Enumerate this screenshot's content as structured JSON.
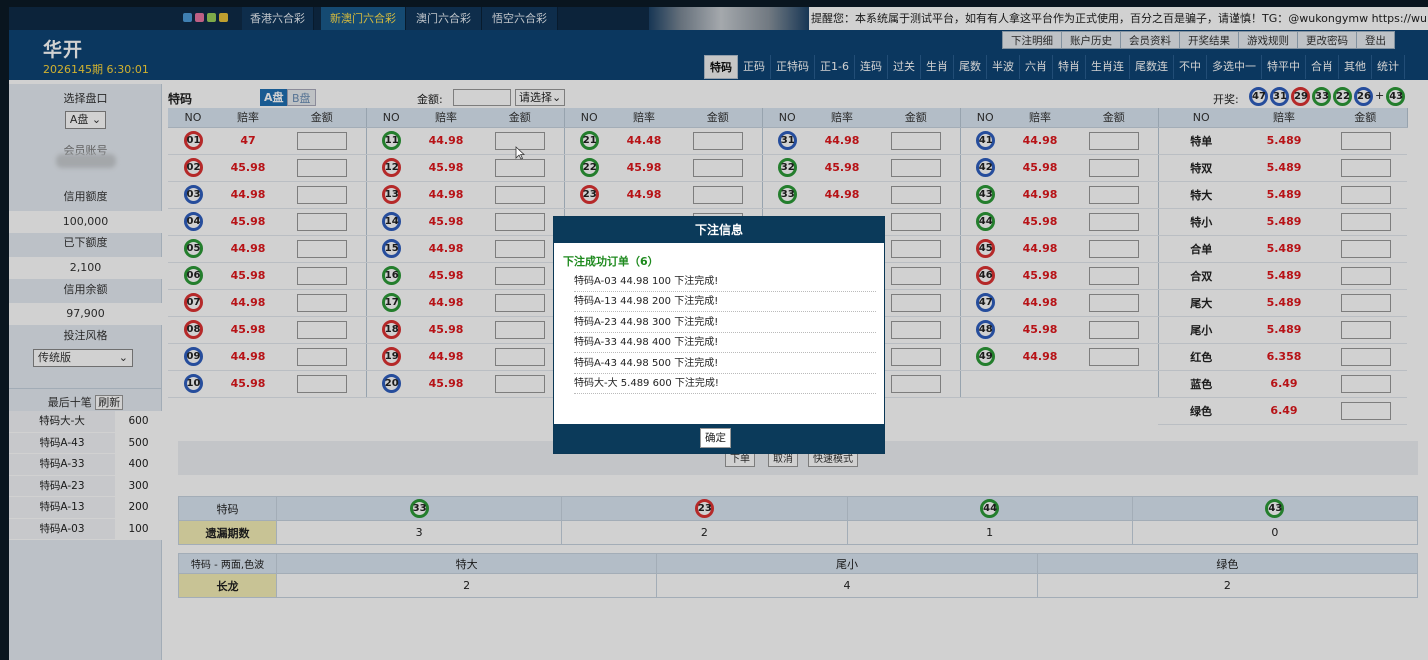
{
  "topbar": {
    "colors": [
      "#4d9bd8",
      "#e874a2",
      "#9ad05a",
      "#e9c23a"
    ],
    "game_tabs": [
      "香港六合彩",
      "新澳门六合彩",
      "澳门六合彩",
      "悟空六合彩"
    ],
    "notice": "提醒您：本系统属于测试平台，如有有人拿这平台作为正式使用，百分之百是骗子，请谨慎！TG：@wukongymw https://wukong"
  },
  "header": {
    "logo": "华开",
    "period": "2026145期 6:30:01",
    "user_links": [
      "下注明细",
      "账户历史",
      "会员资料",
      "开奖结果",
      "游戏规则",
      "更改密码",
      "登出"
    ],
    "main_tabs": [
      "特码",
      "正码",
      "正特码",
      "正1-6",
      "连码",
      "过关",
      "生肖",
      "尾数",
      "半波",
      "六肖",
      "特肖",
      "生肖连",
      "尾数连",
      "不中",
      "多选中一",
      "特平中",
      "合肖",
      "其他",
      "统计"
    ]
  },
  "sidebar": {
    "select_disc_label": "选择盘口",
    "disc_value": "A盘",
    "account_label": "会员账号",
    "credit_label": "信用额度",
    "credit_value": "100,000",
    "placed_label": "已下额度",
    "placed_value": "2,100",
    "balance_label": "信用余额",
    "balance_value": "97,900",
    "style_label": "投注风格",
    "style_value": "传统版",
    "recent_title": "最后十笔",
    "refresh_label": "刷新",
    "recent": [
      {
        "name": "特码大-大",
        "amount": "600"
      },
      {
        "name": "特码A-43",
        "amount": "500"
      },
      {
        "name": "特码A-33",
        "amount": "400"
      },
      {
        "name": "特码A-23",
        "amount": "300"
      },
      {
        "name": "特码A-13",
        "amount": "200"
      },
      {
        "name": "特码A-03",
        "amount": "100"
      }
    ]
  },
  "main": {
    "title": "特码",
    "disc_a": "A盘",
    "disc_b": "B盘",
    "amount_label": "金额:",
    "select_label": "请选择",
    "draw_label": "开奖:",
    "draw_balls": [
      {
        "n": "47",
        "c": "b"
      },
      {
        "n": "31",
        "c": "b"
      },
      {
        "n": "29",
        "c": "r"
      },
      {
        "n": "33",
        "c": "g"
      },
      {
        "n": "22",
        "c": "g"
      },
      {
        "n": "26",
        "c": "b"
      },
      {
        "n": "43",
        "c": "g"
      }
    ],
    "headers": {
      "no": "NO",
      "odds": "赔率",
      "amount": "金额"
    },
    "number_odds": [
      {
        "n": "01",
        "c": "r",
        "o": "47"
      },
      {
        "n": "02",
        "c": "r",
        "o": "45.98"
      },
      {
        "n": "03",
        "c": "b",
        "o": "44.98"
      },
      {
        "n": "04",
        "c": "b",
        "o": "45.98"
      },
      {
        "n": "05",
        "c": "g",
        "o": "44.98"
      },
      {
        "n": "06",
        "c": "g",
        "o": "45.98"
      },
      {
        "n": "07",
        "c": "r",
        "o": "44.98"
      },
      {
        "n": "08",
        "c": "r",
        "o": "45.98"
      },
      {
        "n": "09",
        "c": "b",
        "o": "44.98"
      },
      {
        "n": "10",
        "c": "b",
        "o": "45.98"
      },
      {
        "n": "11",
        "c": "g",
        "o": "44.98"
      },
      {
        "n": "12",
        "c": "r",
        "o": "45.98"
      },
      {
        "n": "13",
        "c": "r",
        "o": "44.98"
      },
      {
        "n": "14",
        "c": "b",
        "o": "45.98"
      },
      {
        "n": "15",
        "c": "b",
        "o": "44.98"
      },
      {
        "n": "16",
        "c": "g",
        "o": "45.98"
      },
      {
        "n": "17",
        "c": "g",
        "o": "44.98"
      },
      {
        "n": "18",
        "c": "r",
        "o": "45.98"
      },
      {
        "n": "19",
        "c": "r",
        "o": "44.98"
      },
      {
        "n": "20",
        "c": "b",
        "o": "45.98"
      },
      {
        "n": "21",
        "c": "g",
        "o": "44.48"
      },
      {
        "n": "22",
        "c": "g",
        "o": "45.98"
      },
      {
        "n": "23",
        "c": "r",
        "o": "44.98"
      },
      {
        "n": "31",
        "c": "b",
        "o": "44.98"
      },
      {
        "n": "32",
        "c": "g",
        "o": "45.98"
      },
      {
        "n": "33",
        "c": "g",
        "o": "44.98"
      },
      {
        "n": "41",
        "c": "b",
        "o": "44.98"
      },
      {
        "n": "42",
        "c": "b",
        "o": "45.98"
      },
      {
        "n": "43",
        "c": "g",
        "o": "44.98"
      },
      {
        "n": "44",
        "c": "g",
        "o": "45.98"
      },
      {
        "n": "45",
        "c": "r",
        "o": "44.98"
      },
      {
        "n": "46",
        "c": "r",
        "o": "45.98"
      },
      {
        "n": "47",
        "c": "b",
        "o": "44.98"
      },
      {
        "n": "48",
        "c": "b",
        "o": "45.98"
      },
      {
        "n": "49",
        "c": "g",
        "o": "44.98"
      }
    ],
    "specials": [
      {
        "name": "特单",
        "odds": "5.489"
      },
      {
        "name": "特双",
        "odds": "5.489"
      },
      {
        "name": "特大",
        "odds": "5.489"
      },
      {
        "name": "特小",
        "odds": "5.489"
      },
      {
        "name": "合单",
        "odds": "5.489"
      },
      {
        "name": "合双",
        "odds": "5.489"
      },
      {
        "name": "尾大",
        "odds": "5.489"
      },
      {
        "name": "尾小",
        "odds": "5.489"
      },
      {
        "name": "红色",
        "odds": "6.358"
      },
      {
        "name": "蓝色",
        "odds": "6.49"
      },
      {
        "name": "绿色",
        "odds": "6.49"
      }
    ],
    "actions": [
      "下单",
      "取消",
      "快速模式"
    ]
  },
  "missing_stats": {
    "label": "特码",
    "row_label": "遗漏期数",
    "balls": [
      {
        "n": "33",
        "c": "g"
      },
      {
        "n": "23",
        "c": "r"
      },
      {
        "n": "44",
        "c": "g"
      },
      {
        "n": "43",
        "c": "g"
      }
    ],
    "counts": [
      "3",
      "2",
      "1",
      "0"
    ]
  },
  "long_stats": {
    "label": "特码 - 两面,色波",
    "row_label": "长龙",
    "items": [
      "特大",
      "尾小",
      "绿色"
    ],
    "counts": [
      "2",
      "4",
      "2"
    ]
  },
  "modal": {
    "title": "下注信息",
    "success": "下注成功订单（6）",
    "lines": [
      "特码A-03 44.98 100 下注完成!",
      "特码A-13 44.98 200 下注完成!",
      "特码A-23 44.98 300 下注完成!",
      "特码A-33 44.98 400 下注完成!",
      "特码A-43 44.98 500 下注完成!",
      "特码大-大 5.489 600 下注完成!"
    ],
    "ok": "确定"
  }
}
